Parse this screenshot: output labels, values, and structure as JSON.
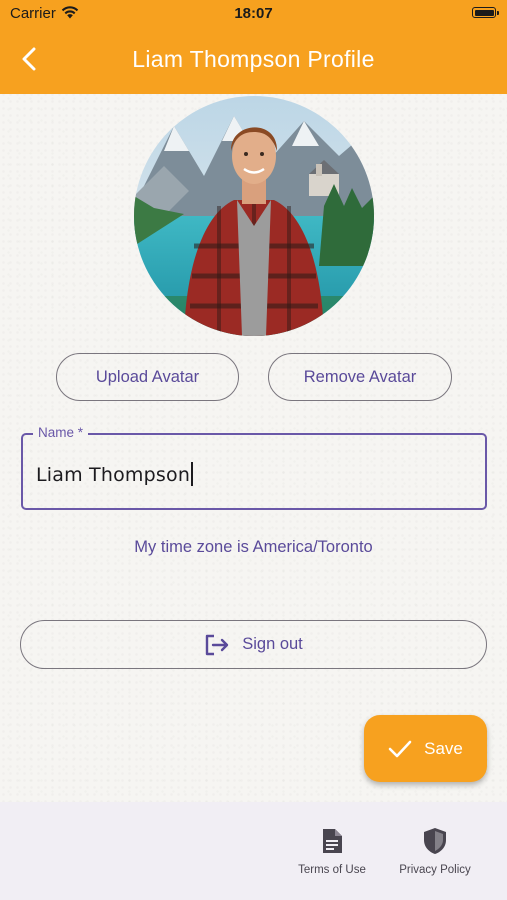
{
  "status_bar": {
    "carrier": "Carrier",
    "time": "18:07"
  },
  "header": {
    "title": "Liam Thompson Profile",
    "back_icon": "chevron-left-icon",
    "color": "#f7a11f"
  },
  "avatar": {
    "alt": "Liam Thompson avatar"
  },
  "actions": {
    "upload_label": "Upload Avatar",
    "remove_label": "Remove Avatar"
  },
  "name_field": {
    "label": "Name *",
    "value": "Liam Thompson"
  },
  "timezone_text": "My time zone is America/Toronto",
  "signout": {
    "label": "Sign out",
    "icon": "logout-icon"
  },
  "save_fab": {
    "label": "Save",
    "icon": "check-icon"
  },
  "bottom_nav": {
    "terms_label": "Terms of Use",
    "privacy_label": "Privacy Policy"
  },
  "colors": {
    "accent": "#f7a11f",
    "primary": "#6a58a8",
    "text_purple": "#5a4a9a"
  }
}
